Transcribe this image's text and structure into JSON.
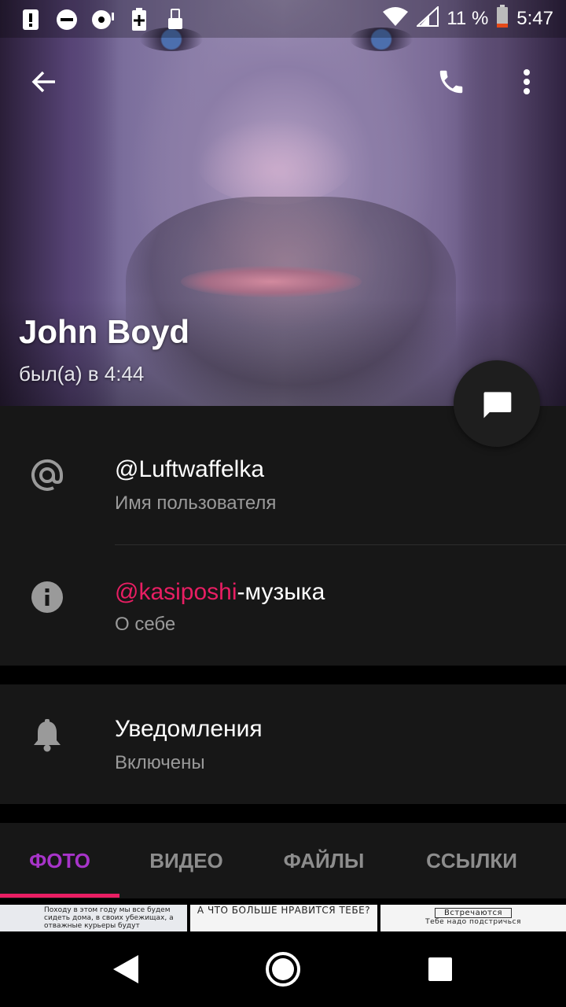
{
  "status_bar": {
    "battery_percent": "11 %",
    "time": "5:47",
    "left_icons": [
      "alert-icon",
      "do-not-disturb-icon",
      "record-icon",
      "battery-saver-icon",
      "sim-icon"
    ]
  },
  "toolbar": {
    "back_icon": "back-arrow-icon",
    "call_icon": "phone-icon",
    "menu_icon": "more-vert-icon"
  },
  "profile": {
    "name": "John Boyd",
    "last_seen": "был(а) в 4:44"
  },
  "info": {
    "username": "@Luftwaffelka",
    "username_label": "Имя пользователя",
    "about_mention": "@kasiposhi",
    "about_rest": "-музыка",
    "about_label": "О себе"
  },
  "notifications": {
    "title": "Уведомления",
    "value": "Включены"
  },
  "tabs": {
    "items": [
      "ФОТО",
      "ВИДЕО",
      "ФАЙЛЫ",
      "ССЫЛКИ"
    ],
    "active_index": 0
  },
  "thumbnails": {
    "t1": "Походу в этом году мы все будем сидеть дома, в своих убежищах, а отважные курьеры будут доставлять нам продовольствие, медикаменты и всё",
    "t2": "А ЧТО БОЛЬШЕ НРАВИТСЯ ТЕБЕ?",
    "t3_title": "Встречаются",
    "t3_sub": "Тебе надо подстричься"
  },
  "colors": {
    "accent_pink": "#e91e63",
    "accent_purple": "#a734c9",
    "card_bg": "#171717"
  }
}
